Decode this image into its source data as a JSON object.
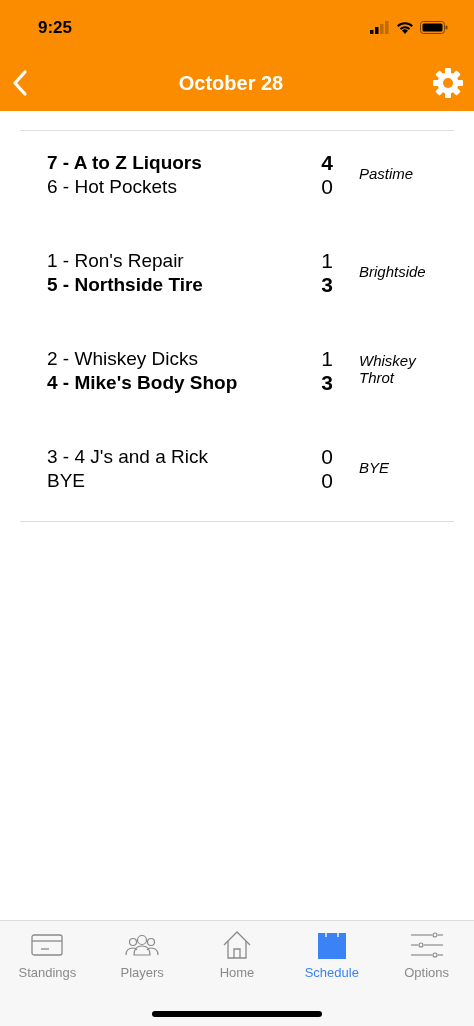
{
  "status_bar": {
    "time": "9:25"
  },
  "nav": {
    "title": "October 28"
  },
  "matches": [
    {
      "teams": [
        {
          "name": "7 - A to Z Liquors",
          "score": "4",
          "winner": true
        },
        {
          "name": "6 - Hot Pockets",
          "score": "0",
          "winner": false
        }
      ],
      "venue": "Pastime"
    },
    {
      "teams": [
        {
          "name": "1 - Ron's Repair",
          "score": "1",
          "winner": false
        },
        {
          "name": "5 - Northside Tire",
          "score": "3",
          "winner": true
        }
      ],
      "venue": "Brightside"
    },
    {
      "teams": [
        {
          "name": "2 - Whiskey Dicks",
          "score": "1",
          "winner": false
        },
        {
          "name": "4 - Mike's Body Shop",
          "score": "3",
          "winner": true
        }
      ],
      "venue": "Whiskey Throt"
    },
    {
      "teams": [
        {
          "name": "3 - 4 J's and a Rick",
          "score": "0",
          "winner": false
        },
        {
          "name": "BYE",
          "score": "0",
          "winner": false
        }
      ],
      "venue": "BYE"
    }
  ],
  "tab_bar": [
    {
      "label": "Standings",
      "kind": "card",
      "selected": false
    },
    {
      "label": "Players",
      "kind": "people",
      "selected": false
    },
    {
      "label": "Home",
      "kind": "house",
      "selected": false
    },
    {
      "label": "Schedule",
      "kind": "calendar",
      "selected": true
    },
    {
      "label": "Options",
      "kind": "sliders",
      "selected": false
    }
  ]
}
